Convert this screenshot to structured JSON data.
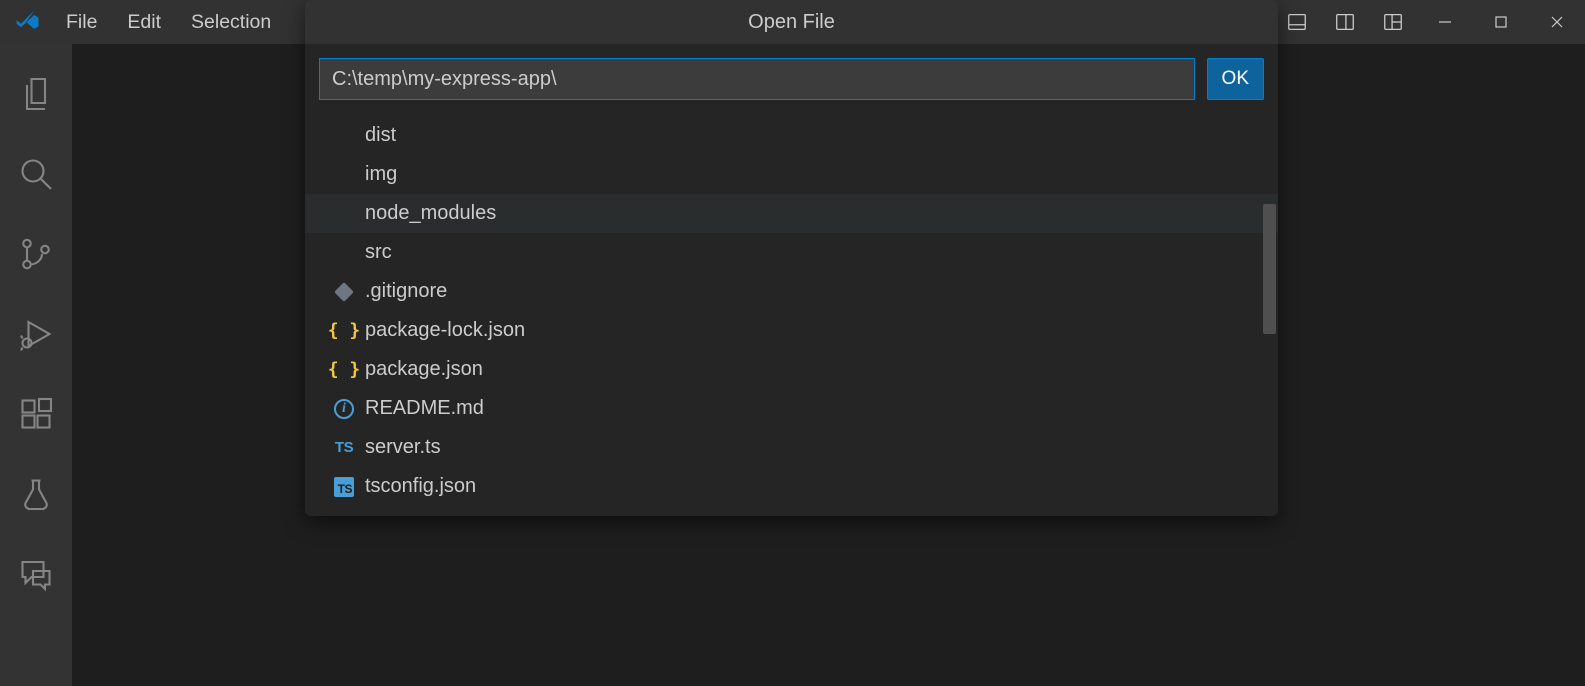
{
  "menu": {
    "file": "File",
    "edit": "Edit",
    "selection": "Selection"
  },
  "quick_input": {
    "title": "Open File",
    "path_value": "C:\\temp\\my-express-app\\",
    "ok_label": "OK",
    "items": [
      {
        "label": "dist",
        "icon": "none",
        "folder": true,
        "hovered": false
      },
      {
        "label": "img",
        "icon": "none",
        "folder": true,
        "hovered": false
      },
      {
        "label": "node_modules",
        "icon": "none",
        "folder": true,
        "hovered": true
      },
      {
        "label": "src",
        "icon": "none",
        "folder": true,
        "hovered": false
      },
      {
        "label": ".gitignore",
        "icon": "diamond",
        "folder": false,
        "hovered": false
      },
      {
        "label": "package-lock.json",
        "icon": "json",
        "folder": false,
        "hovered": false
      },
      {
        "label": "package.json",
        "icon": "json",
        "folder": false,
        "hovered": false
      },
      {
        "label": "README.md",
        "icon": "info",
        "folder": false,
        "hovered": false
      },
      {
        "label": "server.ts",
        "icon": "ts",
        "folder": false,
        "hovered": false
      },
      {
        "label": "tsconfig.json",
        "icon": "tsc",
        "folder": false,
        "hovered": false
      }
    ]
  },
  "activity_bar": [
    "explorer",
    "search",
    "source-control",
    "run-debug",
    "extensions",
    "testing",
    "feedback"
  ],
  "title_layout_icons": [
    "layout-panel",
    "layout-side",
    "layout-custom"
  ],
  "window_controls": [
    "minimize",
    "maximize",
    "close"
  ]
}
